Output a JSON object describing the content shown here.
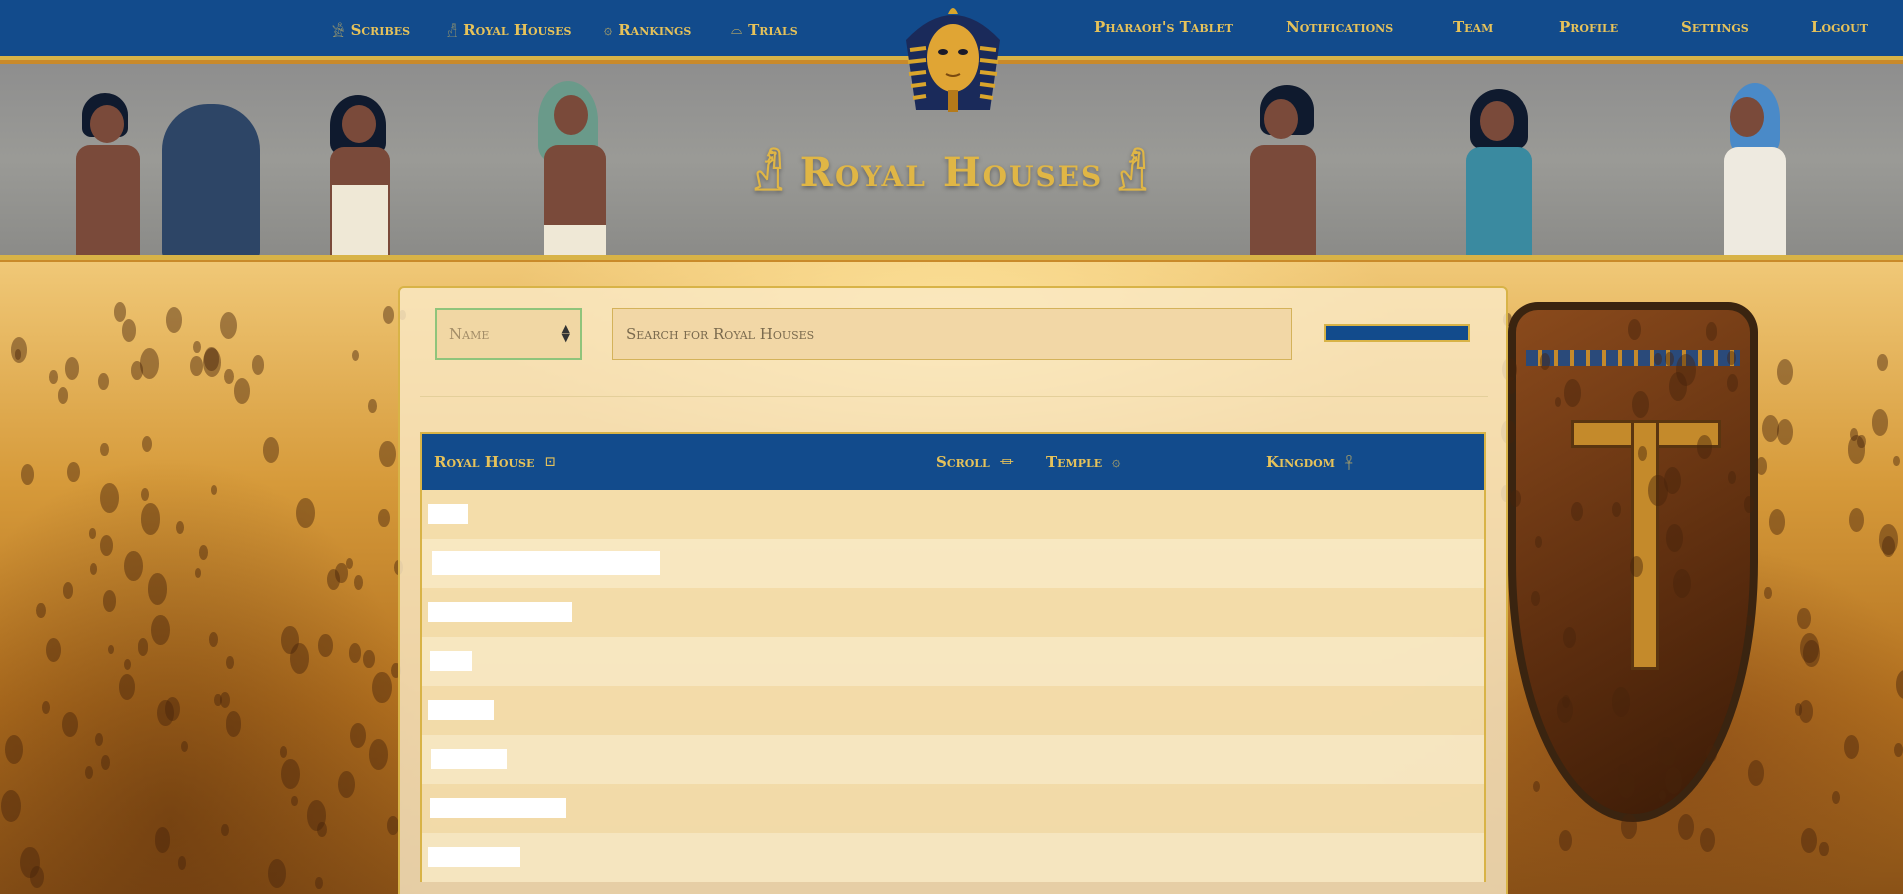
{
  "nav": {
    "left": [
      {
        "label": "Scribes",
        "icon": "scribe-icon",
        "glyph": "𓀀"
      },
      {
        "label": "Royal Houses",
        "icon": "royal-houses-icon",
        "glyph": "𓀭"
      },
      {
        "label": "Rankings",
        "icon": "rankings-icon",
        "glyph": "۞"
      },
      {
        "label": "Trials",
        "icon": "trials-icon",
        "glyph": "⌓"
      }
    ],
    "right": [
      {
        "label": "Pharaoh's Tablet"
      },
      {
        "label": "Notifications"
      },
      {
        "label": "Team"
      },
      {
        "label": "Profile"
      },
      {
        "label": "Settings"
      },
      {
        "label": "Logout"
      }
    ]
  },
  "banner": {
    "title": "Royal Houses",
    "glyph_left": "𓀭",
    "glyph_right": "𓀭"
  },
  "filters": {
    "sort_value": "Name",
    "search_placeholder": "Search for Royal Houses"
  },
  "table": {
    "columns": [
      {
        "label": "Royal House",
        "icon": "cartouche-icon",
        "glyph": "⊡"
      },
      {
        "label": "Scroll",
        "icon": "scroll-icon",
        "glyph": "⏛"
      },
      {
        "label": "Temple",
        "icon": "temple-icon",
        "glyph": "۞"
      },
      {
        "label": "Kingdom",
        "icon": "kingdom-icon",
        "glyph": "𓋹"
      }
    ],
    "rows": [
      {
        "name": ""
      },
      {
        "name": ""
      },
      {
        "name": ""
      },
      {
        "name": ""
      },
      {
        "name": ""
      },
      {
        "name": ""
      },
      {
        "name": ""
      },
      {
        "name": ""
      }
    ]
  },
  "colors": {
    "nav_blue": "#124b8c",
    "gold": "#e6c25a",
    "panel": "#fae9c4"
  }
}
